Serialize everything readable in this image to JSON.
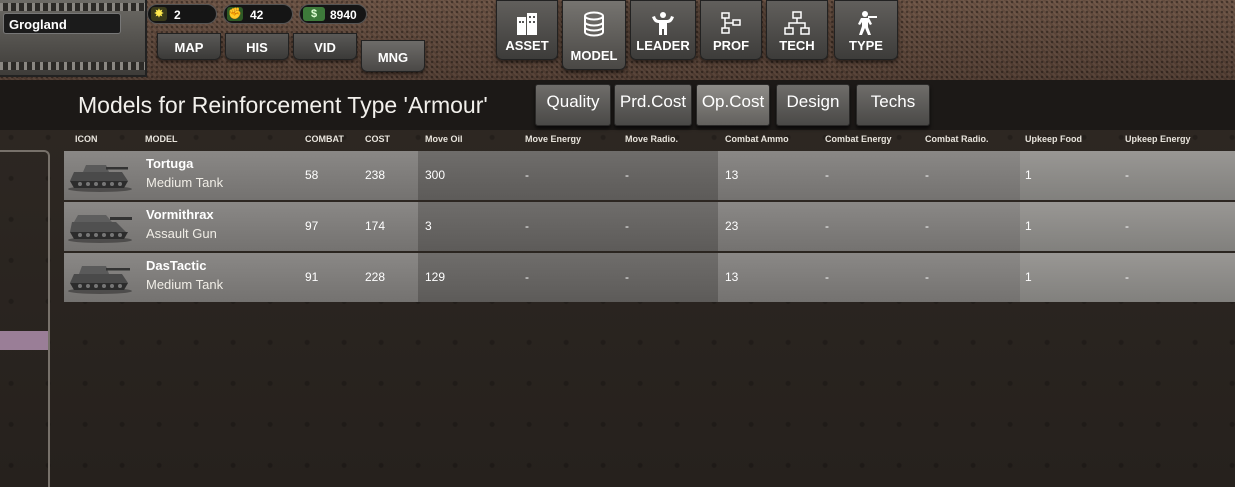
{
  "header": {
    "country": "Grogland",
    "resources": [
      {
        "icon": "star-burst-icon",
        "value": "2"
      },
      {
        "icon": "fist-icon",
        "value": "42"
      },
      {
        "icon": "money-icon",
        "value": "8940"
      }
    ],
    "small_tabs": [
      "MAP",
      "HIS",
      "VID",
      "MNG"
    ],
    "big_tabs": [
      {
        "label": "ASSET",
        "icon": "building-icon"
      },
      {
        "label": "MODEL",
        "icon": "database-icon"
      },
      {
        "label": "LEADER",
        "icon": "strongman-icon"
      },
      {
        "label": "PROF",
        "icon": "flowchart-icon"
      },
      {
        "label": "TECH",
        "icon": "hierarchy-icon"
      },
      {
        "label": "TYPE",
        "icon": "soldier-icon"
      }
    ]
  },
  "page": {
    "title": "Models for Reinforcement Type 'Armour'",
    "filter_buttons": [
      "Quality",
      "Prd.Cost",
      "Op.Cost",
      "Design",
      "Techs"
    ],
    "active_filter": "Op.Cost"
  },
  "table": {
    "columns": [
      "ICON",
      "MODEL",
      "COMBAT",
      "COST",
      "Move Oil",
      "Move Energy",
      "Move Radio.",
      "Combat Ammo",
      "Combat Energy",
      "Combat Radio.",
      "Upkeep Food",
      "Upkeep Energy"
    ],
    "rows": [
      {
        "name": "Tortuga",
        "type": "Medium Tank",
        "combat": "58",
        "cost": "238",
        "move_oil": "300",
        "move_energy": "-",
        "move_radio": "-",
        "combat_ammo": "13",
        "combat_energy": "-",
        "combat_radio": "-",
        "upkeep_food": "1",
        "upkeep_energy": "-"
      },
      {
        "name": "Vormithrax",
        "type": "Assault Gun",
        "combat": "97",
        "cost": "174",
        "move_oil": "3",
        "move_energy": "-",
        "move_radio": "-",
        "combat_ammo": "23",
        "combat_energy": "-",
        "combat_radio": "-",
        "upkeep_food": "1",
        "upkeep_energy": "-"
      },
      {
        "name": "DasTactic",
        "type": "Medium Tank",
        "combat": "91",
        "cost": "228",
        "move_oil": "129",
        "move_energy": "-",
        "move_radio": "-",
        "combat_ammo": "13",
        "combat_energy": "-",
        "combat_radio": "-",
        "upkeep_food": "1",
        "upkeep_energy": "-"
      }
    ]
  }
}
